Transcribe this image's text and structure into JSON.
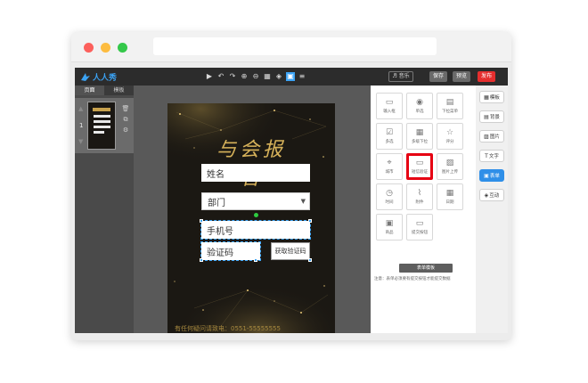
{
  "app": {
    "logo_text": "人人秀",
    "toolbar": {
      "music_label": "♬ 音乐",
      "save_label": "保存",
      "preview_label": "预览",
      "publish_label": "发布"
    }
  },
  "left_panel": {
    "tabs": [
      "页面",
      "模板"
    ],
    "active_tab": "页面",
    "page_number": "1"
  },
  "form": {
    "title": "与会报名",
    "fields": {
      "name": "姓名",
      "department": "部门",
      "phone": "手机号",
      "code": "验证码",
      "get_code": "获取验证码"
    },
    "footer": "有任何疑问请致电：0551-55555555"
  },
  "components": [
    {
      "label": "输入框",
      "icon": "input-icon"
    },
    {
      "label": "单选",
      "icon": "radio-icon"
    },
    {
      "label": "下拉菜单",
      "icon": "dropdown-icon"
    },
    {
      "label": "多选",
      "icon": "checkbox-icon"
    },
    {
      "label": "多级下拉",
      "icon": "multilevel-icon"
    },
    {
      "label": "评分",
      "icon": "star-icon"
    },
    {
      "label": "城市",
      "icon": "location-icon"
    },
    {
      "label": "短信验证",
      "icon": "sms-icon",
      "highlighted": true
    },
    {
      "label": "图片上传",
      "icon": "image-upload-icon"
    },
    {
      "label": "时间",
      "icon": "clock-icon"
    },
    {
      "label": "附件",
      "icon": "attachment-icon"
    },
    {
      "label": "日期",
      "icon": "calendar-icon"
    },
    {
      "label": "商品",
      "icon": "product-icon"
    },
    {
      "label": "提交按钮",
      "icon": "submit-icon"
    }
  ],
  "right_panel": {
    "submit_model_label": "表单模板",
    "note": "注意：表单必须要有提交按钮才能提交数据"
  },
  "side_tabs": [
    {
      "label": "模板",
      "icon": "template-icon"
    },
    {
      "label": "背景",
      "icon": "background-icon"
    },
    {
      "label": "图片",
      "icon": "image-icon"
    },
    {
      "label": "文字",
      "icon": "text-icon"
    },
    {
      "label": "表单",
      "icon": "form-icon",
      "active": true
    },
    {
      "label": "互动",
      "icon": "interaction-icon"
    }
  ],
  "colors": {
    "accent": "#3ba3f5",
    "publish": "#e52e2e",
    "highlight": "#e60012",
    "gold": "#d7b25a"
  }
}
